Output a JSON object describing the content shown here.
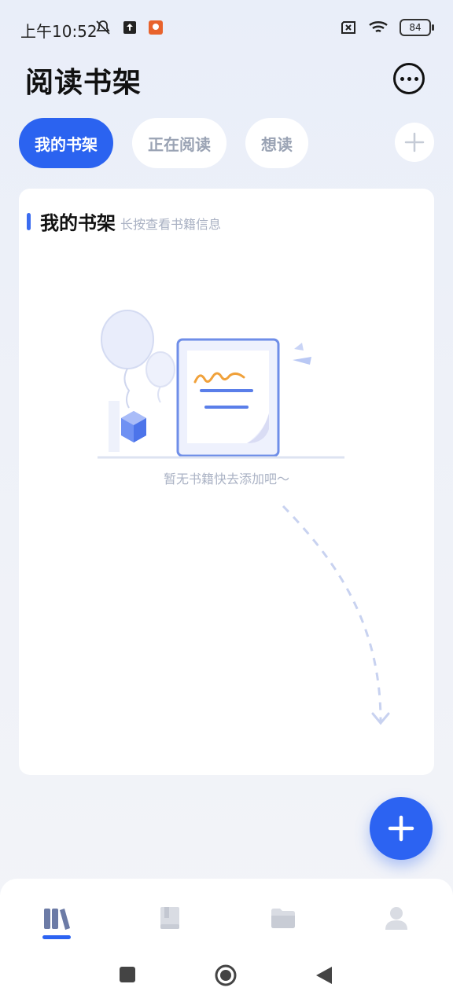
{
  "status_bar": {
    "time": "上午10:52",
    "battery": "84",
    "network_icon": "wifi-icon"
  },
  "header": {
    "title": "阅读书架",
    "more_icon": "more-icon"
  },
  "tabs": [
    {
      "label": "我的书架",
      "active": true
    },
    {
      "label": "正在阅读",
      "active": false
    },
    {
      "label": "想读",
      "active": false
    }
  ],
  "shelf_card": {
    "title": "我的书架",
    "hint": "长按查看书籍信息",
    "empty_text": "暂无书籍快去添加吧～"
  },
  "bottom_nav": [
    {
      "icon": "bookshelf-icon",
      "active": true
    },
    {
      "icon": "book-icon",
      "active": false
    },
    {
      "icon": "folder-icon",
      "active": false
    },
    {
      "icon": "user-icon",
      "active": false
    }
  ],
  "colors": {
    "accent": "#2c63f2",
    "muted_text": "#a9b1c3"
  }
}
